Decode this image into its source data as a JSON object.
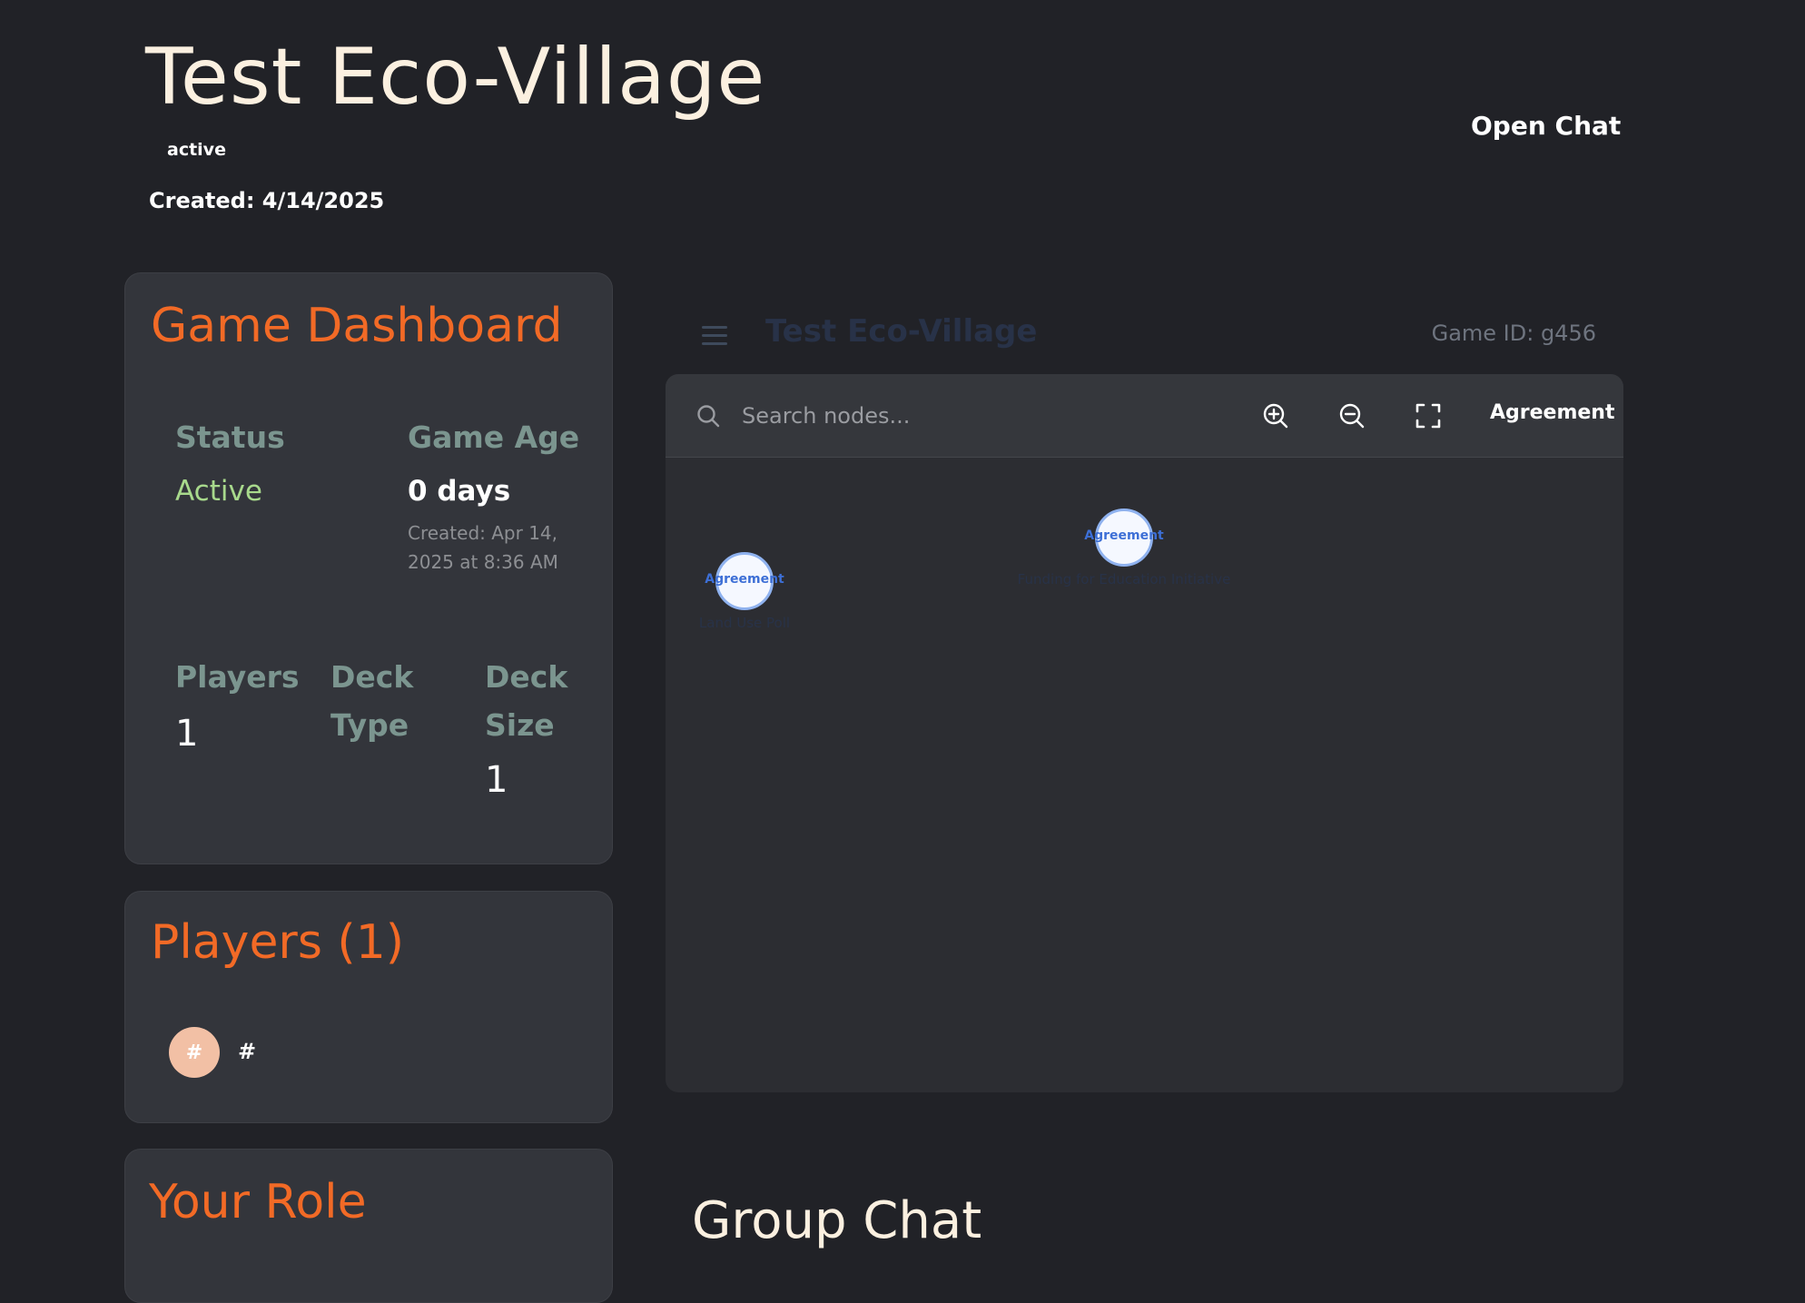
{
  "header": {
    "title": "Test Eco-Village",
    "status": "active",
    "created": "Created: 4/14/2025",
    "open_chat": "Open Chat"
  },
  "dashboard": {
    "title": "Game Dashboard",
    "status_label": "Status",
    "status_value": "Active",
    "age_label": "Game Age",
    "age_value": "0 days",
    "age_created_line1": "Created: Apr 14,",
    "age_created_line2": "2025 at 8:36 AM",
    "players_label": "Players",
    "players_value": "1",
    "deck_type_label_1": "Deck",
    "deck_type_label_2": "Type",
    "deck_size_label_1": "Deck",
    "deck_size_label_2": "Size",
    "deck_size_value": "1"
  },
  "players_card": {
    "title": "Players (1)",
    "players": [
      {
        "avatar_initial": "#",
        "name": "#"
      }
    ]
  },
  "role_card": {
    "title": "Your Role"
  },
  "map": {
    "title": "Test Eco-Village",
    "game_id": "Game ID: g456",
    "search_placeholder": "Search nodes...",
    "filter_label": "Agreement",
    "icons": [
      "search-icon",
      "zoom-in-icon",
      "zoom-out-icon",
      "fullscreen-icon",
      "menu-icon"
    ],
    "nodes": [
      {
        "type": "Agreement",
        "label": "Land Use Poll"
      },
      {
        "type": "Agreement",
        "label": "Funding for Education Initiative"
      }
    ]
  },
  "group_chat": {
    "title": "Group Chat"
  },
  "colors": {
    "background": "#212227",
    "card": "#33353b",
    "accent": "#f26a26",
    "status_active": "#a8d98c",
    "label": "#7b958f",
    "node_border": "#8fb2ef",
    "node_text": "#3d6fd6"
  }
}
